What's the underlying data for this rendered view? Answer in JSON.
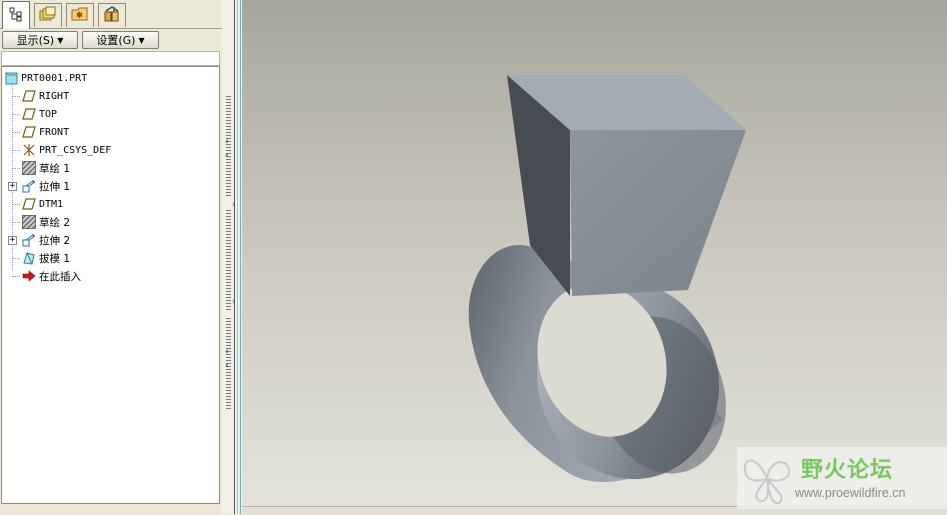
{
  "tabs": [
    {
      "icon": "model-tree-icon"
    },
    {
      "icon": "folder-browser-icon"
    },
    {
      "icon": "favorites-icon"
    },
    {
      "icon": "connections-icon"
    }
  ],
  "toolbar": {
    "show_label": "显示(S)",
    "settings_label": "设置(G)"
  },
  "tree": {
    "items": [
      {
        "label": "PRT0001.PRT",
        "icon": "part-icon"
      },
      {
        "label": "RIGHT",
        "icon": "datum-plane-icon"
      },
      {
        "label": "TOP",
        "icon": "datum-plane-icon"
      },
      {
        "label": "FRONT",
        "icon": "datum-plane-icon"
      },
      {
        "label": "PRT_CSYS_DEF",
        "icon": "coordinate-system-icon"
      },
      {
        "label": "草绘 1",
        "icon": "sketch-icon"
      },
      {
        "label": "拉伸 1",
        "icon": "extrude-icon",
        "expandable": true
      },
      {
        "label": "DTM1",
        "icon": "datum-plane-icon"
      },
      {
        "label": "草绘 2",
        "icon": "sketch-icon"
      },
      {
        "label": "拉伸 2",
        "icon": "extrude-icon",
        "expandable": true
      },
      {
        "label": "拔模 1",
        "icon": "draft-icon"
      },
      {
        "label": "在此插入",
        "icon": "insert-here-arrow-icon"
      }
    ]
  },
  "watermark": {
    "title": "野火论坛",
    "url": "www.proewildfire.cn",
    "accent": "#78c860"
  },
  "colors": {
    "panel_bg": "#ece9d8",
    "sash_accent": "#1b4fc4",
    "model_face_dark": "#4a4f55",
    "model_face_light": "#a3abb4"
  }
}
